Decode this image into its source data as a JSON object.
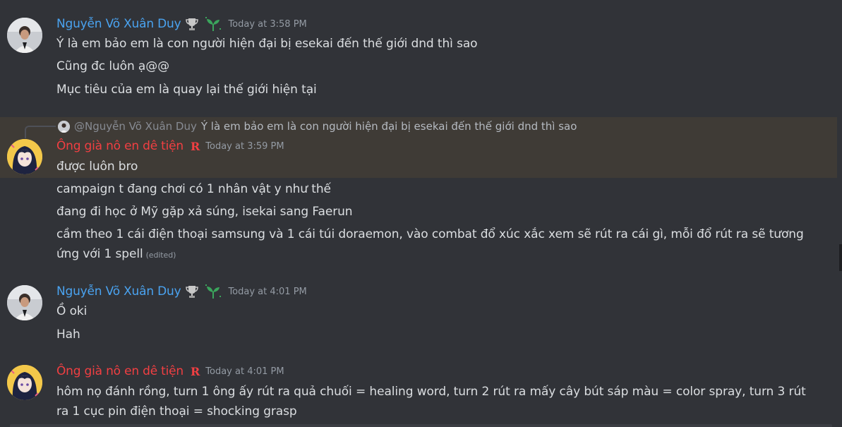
{
  "messages": [
    {
      "author": "Nguyễn Võ Xuân Duy",
      "timestamp": "Today at 3:58 PM",
      "lines": [
        "Ý là em bảo em là con người hiện đại bị esekai đến thế giới dnd thì sao",
        "Cũng đc luôn ạ@@",
        "Mục tiêu của em là quay lại thế giới hiện tại"
      ]
    },
    {
      "reply": {
        "author": "@Nguyễn Võ Xuân Duy",
        "text": "Ý là em bảo em là con người hiện đại bị esekai đến thế giới dnd thì sao"
      },
      "author": "Ông già nô en dê tiện",
      "badge": "R",
      "timestamp": "Today at 3:59 PM",
      "lines": [
        "được luôn bro",
        "campaign t đang chơi có 1 nhân vật y như thế",
        "đang đi học ở Mỹ gặp xả súng, isekai sang Faerun",
        "cầm theo 1 cái điện thoại samsung và 1 cái túi doraemon, vào combat đổ xúc xắc xem sẽ rút ra cái gì, mỗi đổ rút ra sẽ tương",
        "ứng với 1 spell"
      ],
      "edited": "(edited)"
    },
    {
      "author": "Nguyễn Võ Xuân Duy",
      "timestamp": "Today at 4:01 PM",
      "lines": [
        "Ồ oki",
        "Hah"
      ]
    },
    {
      "author": "Ông già nô en dê tiện",
      "badge": "R",
      "timestamp": "Today at 4:01 PM",
      "lines": [
        "hôm nọ đánh rồng, turn 1 ông ấy rút ra quả chuối = healing word, turn 2 rút ra mấy cây bút sáp màu = color spray, turn 3 rút",
        "ra 1 cục pin điện thoại = shocking grasp"
      ]
    }
  ],
  "icons": {
    "trophy": "trophy-icon",
    "sprout": "sprout-icon",
    "role_badge": "role-badge-icon"
  },
  "colors": {
    "background": "#313338",
    "highlight": "#3f3b36",
    "name_blue": "#4aa3f0",
    "name_red": "#f23f42",
    "text": "#dbdee1",
    "muted": "#949ba4"
  }
}
